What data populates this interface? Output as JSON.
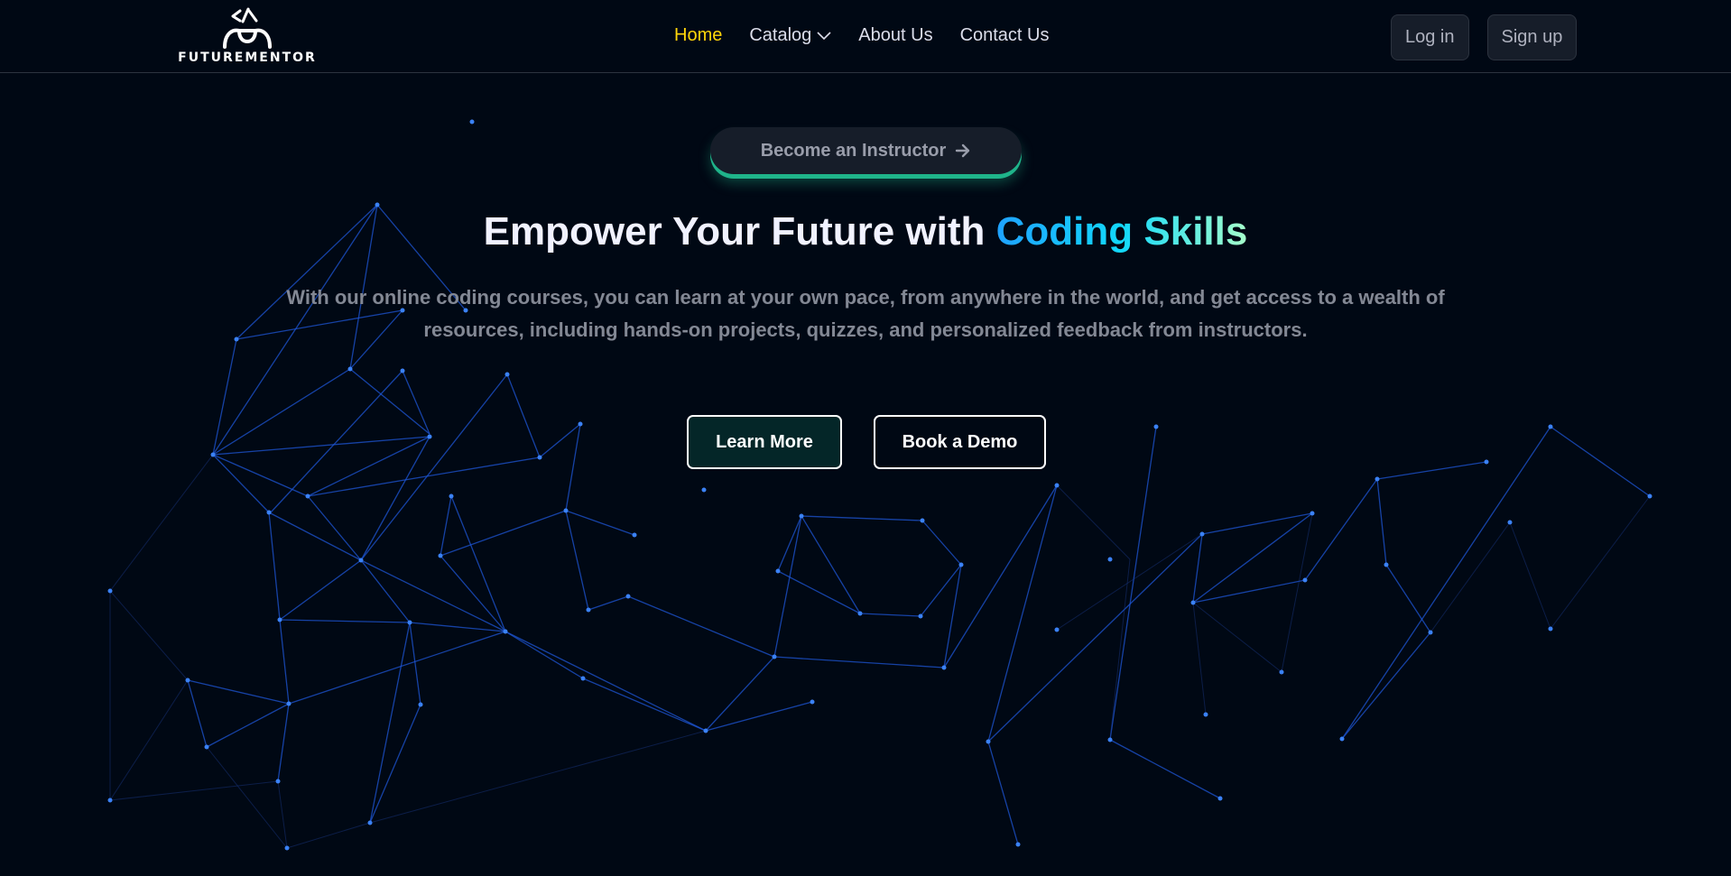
{
  "brand": {
    "name": "FUTUREMENTOR",
    "logo_icon": "code-brackets-logo-icon"
  },
  "nav": {
    "items": [
      {
        "label": "Home",
        "active": true
      },
      {
        "label": "Catalog",
        "has_dropdown": true,
        "icon": "chevron-down-icon"
      },
      {
        "label": "About Us"
      },
      {
        "label": "Contact Us"
      }
    ]
  },
  "auth": {
    "login_label": "Log in",
    "signup_label": "Sign up"
  },
  "hero": {
    "instructor_label": "Become an Instructor",
    "instructor_icon": "arrow-right-icon",
    "headline_prefix": "Empower Your Future with",
    "headline_highlight": "Coding Skills",
    "subtext": "With our online coding courses, you can learn at your own pace, from anywhere in the world, and get access to a wealth of resources, including hands-on projects, quizzes, and personalized feedback from instructors.",
    "learn_more_label": "Learn More",
    "book_demo_label": "Book a Demo"
  },
  "theme": {
    "background": "#000814",
    "active_nav": "#ffd60a",
    "highlight_gradient": [
      "#1fa2ff",
      "#12d8fa",
      "#a6ffcb"
    ],
    "network_line": "#1e56d6",
    "button_glow": "#1fb48a"
  }
}
